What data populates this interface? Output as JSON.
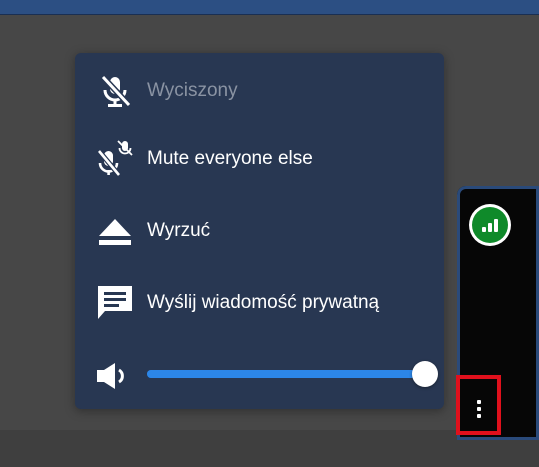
{
  "menu": {
    "items": [
      {
        "id": "muted",
        "label": "Wyciszony",
        "icon": "microphone-off-icon",
        "disabled": true
      },
      {
        "id": "mute-others",
        "label": "Mute everyone else",
        "icon": "mute-others-icon",
        "disabled": false
      },
      {
        "id": "kick",
        "label": "Wyrzuć",
        "icon": "eject-icon",
        "disabled": false
      },
      {
        "id": "private-message",
        "label": "Wyślij wiadomość prywatną",
        "icon": "message-icon",
        "disabled": false
      }
    ],
    "volume": {
      "icon": "volume-icon",
      "value": 1.0
    }
  },
  "participant": {
    "signal_icon": "connection-signal-icon",
    "menu_icon": "more-vertical-icon"
  },
  "colors": {
    "popup_bg": "#283752",
    "accent": "#2c86e8",
    "highlight": "#e0101c",
    "signal_good": "#0f8a2a",
    "disabled_text": "#8a93a3"
  }
}
